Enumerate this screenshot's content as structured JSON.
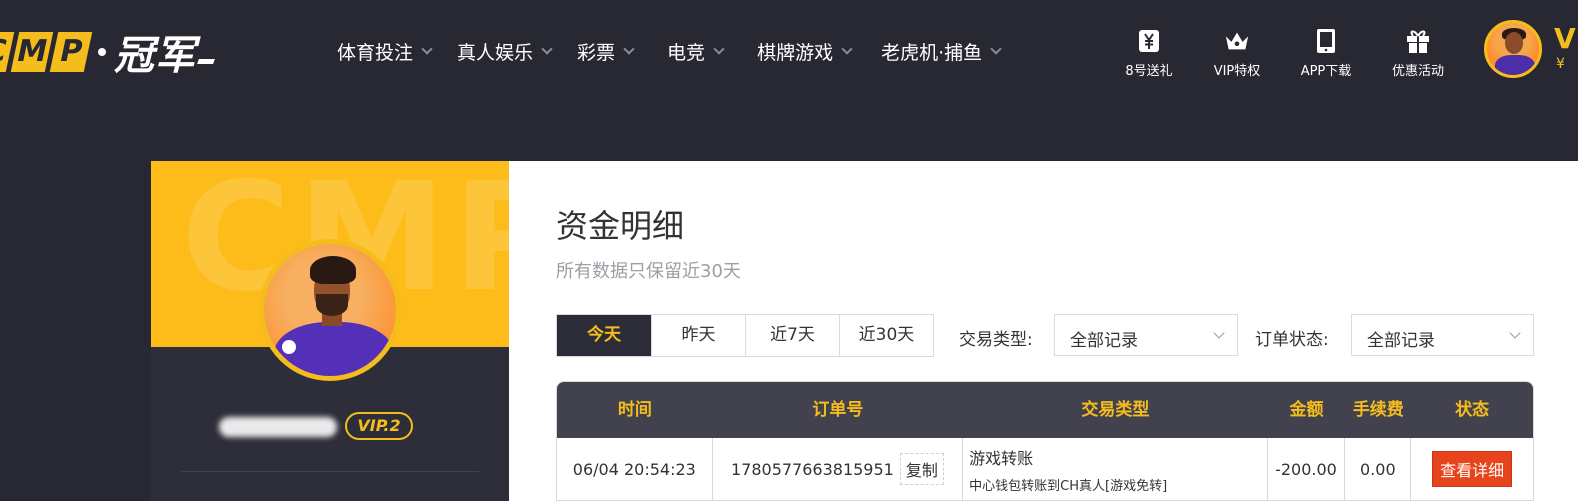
{
  "brand": {
    "logo_letters": [
      "C",
      "M",
      "P"
    ],
    "logo_cn": "冠军",
    "color_accent": "#f5bd1c",
    "color_dark": "#282833"
  },
  "nav": {
    "items": [
      {
        "label": "体育投注"
      },
      {
        "label": "真人娱乐"
      },
      {
        "label": "彩票"
      },
      {
        "label": "电竞"
      },
      {
        "label": "棋牌游戏"
      },
      {
        "label": "老虎机·捕鱼"
      }
    ],
    "quick": [
      {
        "label": "8号送礼",
        "icon": "yen-gift-icon"
      },
      {
        "label": "VIP特权",
        "icon": "crown-icon"
      },
      {
        "label": "APP下载",
        "icon": "tablet-icon"
      },
      {
        "label": "优惠活动",
        "icon": "gift-icon"
      }
    ]
  },
  "user": {
    "name_initial": "V",
    "balance_prefix": "¥",
    "vip_level": "VIP.2"
  },
  "page": {
    "title": "资金明细",
    "subtitle": "所有数据只保留近30天",
    "date_tabs": [
      {
        "label": "今天",
        "active": true
      },
      {
        "label": "昨天",
        "active": false
      },
      {
        "label": "近7天",
        "active": false
      },
      {
        "label": "近30天",
        "active": false
      }
    ],
    "filters": {
      "type_label": "交易类型:",
      "type_value": "全部记录",
      "status_label": "订单状态:",
      "status_value": "全部记录"
    }
  },
  "table": {
    "columns": [
      "时间",
      "订单号",
      "交易类型",
      "金额",
      "手续费",
      "状态"
    ],
    "rows": [
      {
        "time": "06/04 20:54:23",
        "order_no": "1780577663815951",
        "copy_label": "复制",
        "type": "游戏转账",
        "type_desc": "中心钱包转账到CH真人[游戏免转]",
        "amount": "-200.00",
        "fee": "0.00",
        "status_button": "查看详细"
      }
    ]
  }
}
